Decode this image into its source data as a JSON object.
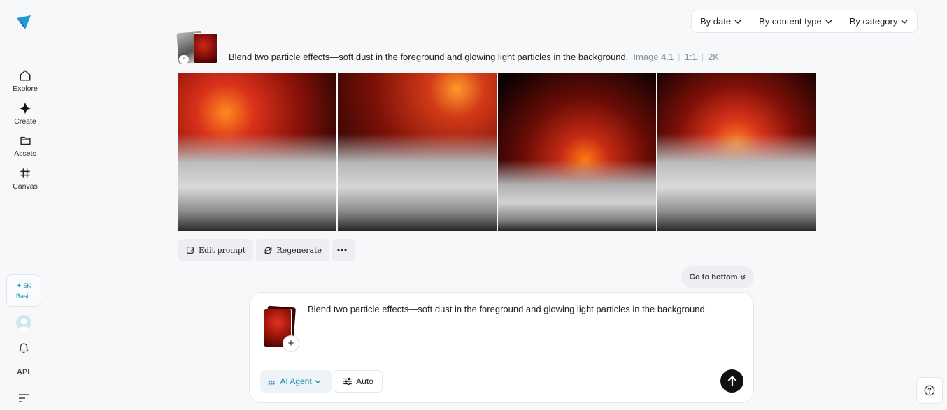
{
  "sidebar": {
    "items": [
      {
        "label": "Explore",
        "icon": "home-icon"
      },
      {
        "label": "Create",
        "icon": "sparkle-icon"
      },
      {
        "label": "Assets",
        "icon": "folder-icon"
      },
      {
        "label": "Canvas",
        "icon": "hash-icon"
      }
    ],
    "credits": {
      "amount": "✦ 5K",
      "plan": "Basic"
    },
    "api_label": "API"
  },
  "filters": [
    {
      "label": "By date"
    },
    {
      "label": "By content type"
    },
    {
      "label": "By category"
    }
  ],
  "generation": {
    "prompt": "Blend two particle effects—soft dust in the foreground and glowing light particles in the background.",
    "model": "Image 4.1",
    "ratio": "1:1",
    "resolution": "2K",
    "images": 4
  },
  "actions": {
    "edit_prompt": "Edit prompt",
    "regenerate": "Regenerate"
  },
  "go_to_bottom": "Go to bottom",
  "composer": {
    "text": "Blend two particle effects—soft dust in the foreground and glowing light particles in the background.",
    "agent_label": "AI Agent",
    "auto_label": "Auto"
  },
  "colors": {
    "accent": "#1d8fb5",
    "send_button": "#111111",
    "background": "#f7f8fa"
  }
}
